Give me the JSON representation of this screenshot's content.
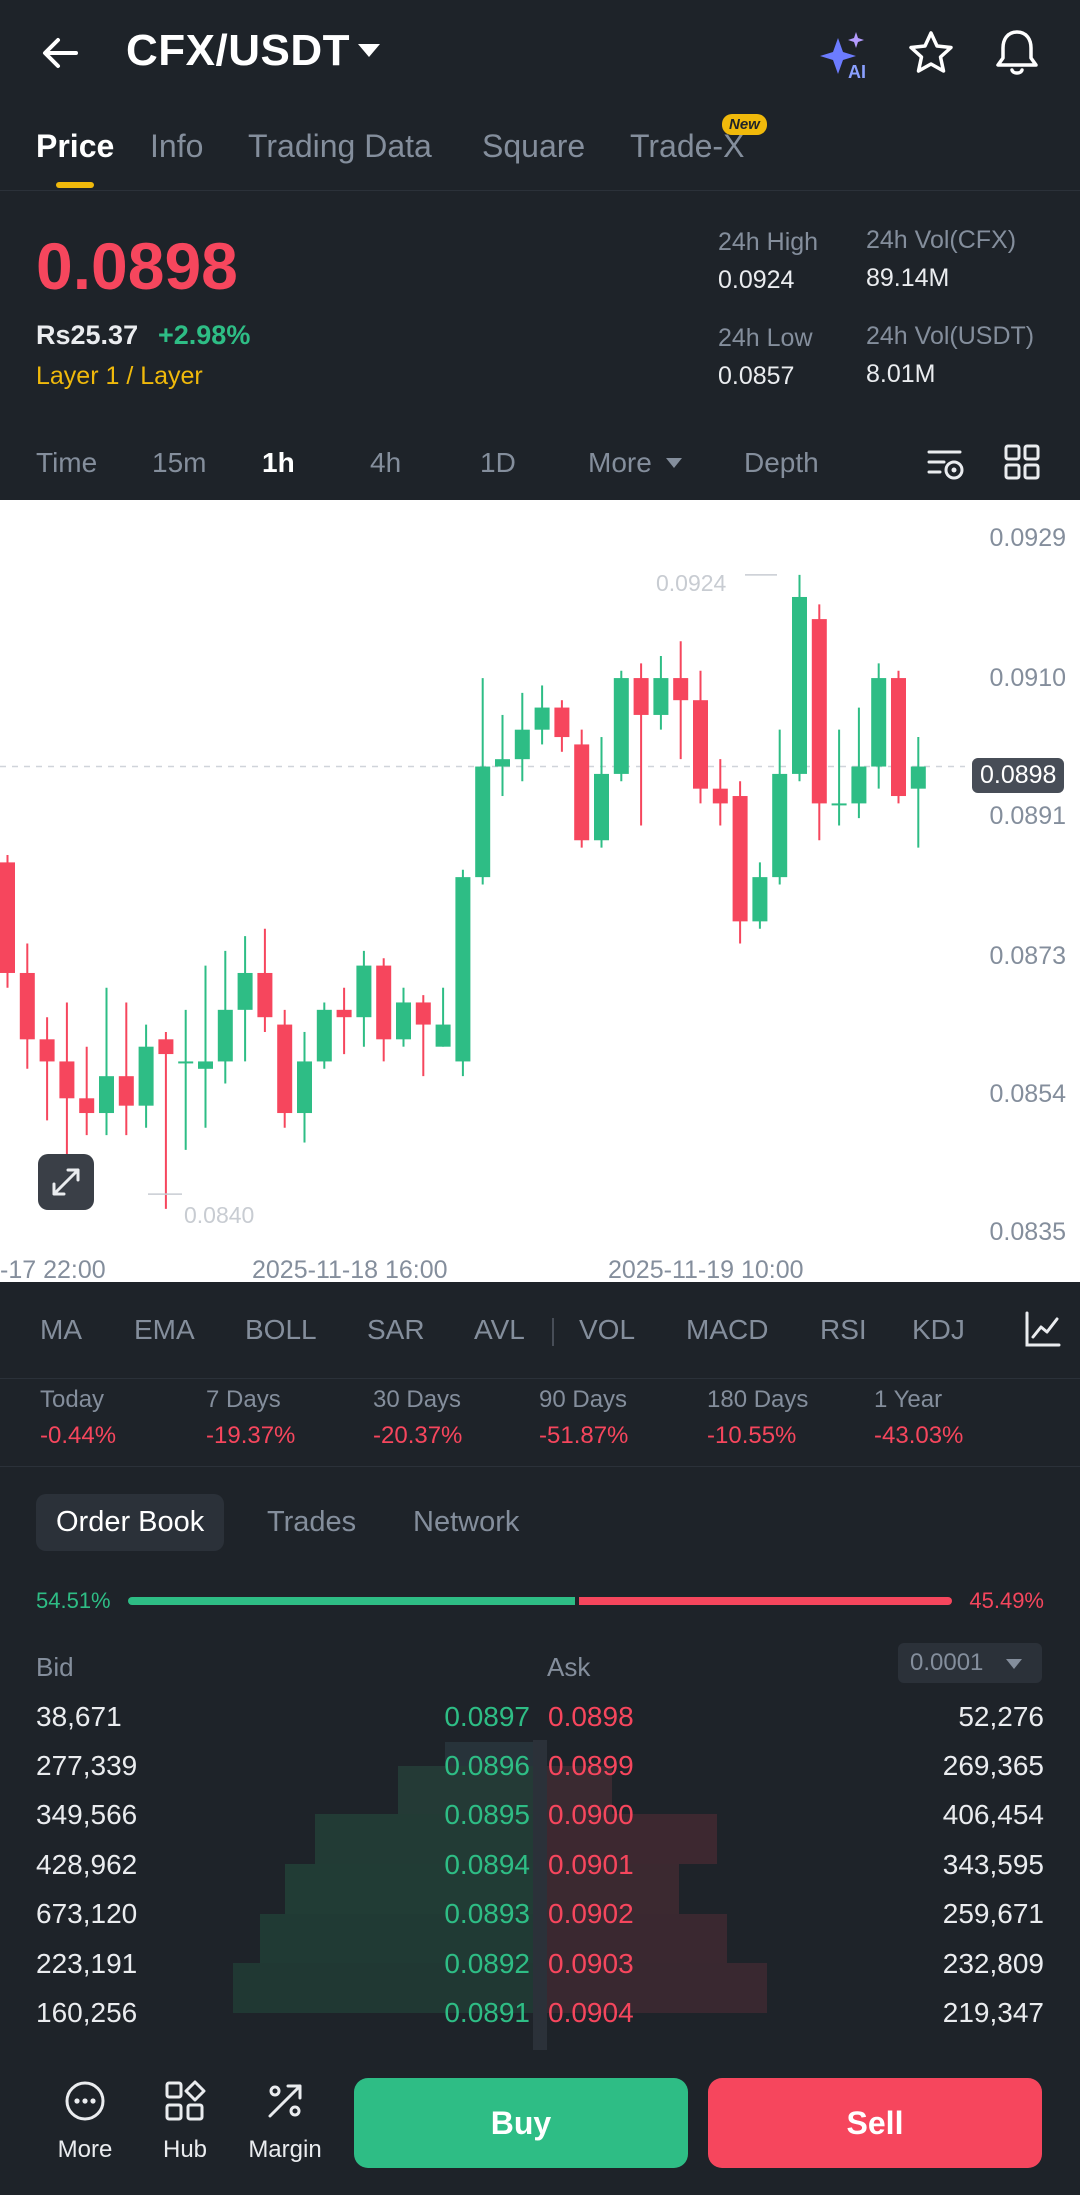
{
  "header": {
    "pair": "CFX/USDT",
    "ai_label": "AI"
  },
  "tabs": [
    {
      "label": "Price",
      "active": true
    },
    {
      "label": "Info"
    },
    {
      "label": "Trading Data"
    },
    {
      "label": "Square"
    },
    {
      "label": "Trade-X",
      "badge": "New"
    }
  ],
  "price": {
    "last": "0.0898",
    "fiat": "Rs25.37",
    "change": "+2.98%",
    "tag": "Layer 1 / Layer"
  },
  "stats": {
    "high_label": "24h High",
    "high": "0.0924",
    "low_label": "24h Low",
    "low": "0.0857",
    "vol_base_label": "24h Vol(CFX)",
    "vol_base": "89.14M",
    "vol_quote_label": "24h Vol(USDT)",
    "vol_quote": "8.01M"
  },
  "intervals": [
    "Time",
    "15m",
    "1h",
    "4h",
    "1D",
    "More",
    "Depth"
  ],
  "active_interval": "1h",
  "chart_data": {
    "type": "candlestick",
    "y_ticks": [
      "0.0929",
      "0.0910",
      "0.0891",
      "0.0873",
      "0.0854",
      "0.0835"
    ],
    "x_ticks": [
      "-17 22:00",
      "2025-11-18 16:00",
      "2025-11-19 10:00"
    ],
    "high_label": "0.0924",
    "low_label": "0.0840",
    "current_price": "0.0898",
    "ylim": [
      0.0835,
      0.0929
    ],
    "candles": [
      {
        "o": 0.0885,
        "c": 0.087,
        "h": 0.0886,
        "l": 0.0868
      },
      {
        "o": 0.087,
        "c": 0.0861,
        "h": 0.0874,
        "l": 0.0857
      },
      {
        "o": 0.0861,
        "c": 0.0858,
        "h": 0.0864,
        "l": 0.085
      },
      {
        "o": 0.0858,
        "c": 0.0853,
        "h": 0.0866,
        "l": 0.0843
      },
      {
        "o": 0.0853,
        "c": 0.0851,
        "h": 0.086,
        "l": 0.0848
      },
      {
        "o": 0.0851,
        "c": 0.0856,
        "h": 0.0868,
        "l": 0.0848
      },
      {
        "o": 0.0856,
        "c": 0.0852,
        "h": 0.0866,
        "l": 0.0848
      },
      {
        "o": 0.0852,
        "c": 0.086,
        "h": 0.0863,
        "l": 0.0849
      },
      {
        "o": 0.0861,
        "c": 0.0859,
        "h": 0.0862,
        "l": 0.0838
      },
      {
        "o": 0.0858,
        "c": 0.0858,
        "h": 0.0865,
        "l": 0.0846
      },
      {
        "o": 0.0857,
        "c": 0.0858,
        "h": 0.0871,
        "l": 0.0849
      },
      {
        "o": 0.0858,
        "c": 0.0865,
        "h": 0.0873,
        "l": 0.0855
      },
      {
        "o": 0.0865,
        "c": 0.087,
        "h": 0.0875,
        "l": 0.0858
      },
      {
        "o": 0.087,
        "c": 0.0864,
        "h": 0.0876,
        "l": 0.0862
      },
      {
        "o": 0.0863,
        "c": 0.0851,
        "h": 0.0865,
        "l": 0.0849
      },
      {
        "o": 0.0851,
        "c": 0.0858,
        "h": 0.0862,
        "l": 0.0847
      },
      {
        "o": 0.0858,
        "c": 0.0865,
        "h": 0.0866,
        "l": 0.0857
      },
      {
        "o": 0.0865,
        "c": 0.0864,
        "h": 0.0868,
        "l": 0.0859
      },
      {
        "o": 0.0864,
        "c": 0.0871,
        "h": 0.0873,
        "l": 0.086
      },
      {
        "o": 0.0871,
        "c": 0.0861,
        "h": 0.0872,
        "l": 0.0858
      },
      {
        "o": 0.0861,
        "c": 0.0866,
        "h": 0.0868,
        "l": 0.086
      },
      {
        "o": 0.0866,
        "c": 0.0863,
        "h": 0.0867,
        "l": 0.0856
      },
      {
        "o": 0.086,
        "c": 0.0863,
        "h": 0.0868,
        "l": 0.086
      },
      {
        "o": 0.0858,
        "c": 0.0883,
        "h": 0.0884,
        "l": 0.0856
      },
      {
        "o": 0.0883,
        "c": 0.0898,
        "h": 0.091,
        "l": 0.0882
      },
      {
        "o": 0.0898,
        "c": 0.0899,
        "h": 0.0905,
        "l": 0.0894
      },
      {
        "o": 0.0899,
        "c": 0.0903,
        "h": 0.0908,
        "l": 0.0896
      },
      {
        "o": 0.0903,
        "c": 0.0906,
        "h": 0.0909,
        "l": 0.0901
      },
      {
        "o": 0.0906,
        "c": 0.0902,
        "h": 0.0907,
        "l": 0.09
      },
      {
        "o": 0.0901,
        "c": 0.0888,
        "h": 0.0903,
        "l": 0.0887
      },
      {
        "o": 0.0888,
        "c": 0.0897,
        "h": 0.0902,
        "l": 0.0887
      },
      {
        "o": 0.0897,
        "c": 0.091,
        "h": 0.0911,
        "l": 0.0896
      },
      {
        "o": 0.091,
        "c": 0.0905,
        "h": 0.0912,
        "l": 0.089
      },
      {
        "o": 0.0905,
        "c": 0.091,
        "h": 0.0913,
        "l": 0.0903
      },
      {
        "o": 0.091,
        "c": 0.0907,
        "h": 0.0915,
        "l": 0.0899
      },
      {
        "o": 0.0907,
        "c": 0.0895,
        "h": 0.0911,
        "l": 0.0893
      },
      {
        "o": 0.0895,
        "c": 0.0893,
        "h": 0.0899,
        "l": 0.089
      },
      {
        "o": 0.0894,
        "c": 0.0877,
        "h": 0.0896,
        "l": 0.0874
      },
      {
        "o": 0.0877,
        "c": 0.0883,
        "h": 0.0885,
        "l": 0.0876
      },
      {
        "o": 0.0883,
        "c": 0.0897,
        "h": 0.0903,
        "l": 0.0882
      },
      {
        "o": 0.0897,
        "c": 0.0921,
        "h": 0.0924,
        "l": 0.0896
      },
      {
        "o": 0.0918,
        "c": 0.0893,
        "h": 0.092,
        "l": 0.0888
      },
      {
        "o": 0.0893,
        "c": 0.0893,
        "h": 0.0903,
        "l": 0.089
      },
      {
        "o": 0.0893,
        "c": 0.0898,
        "h": 0.0906,
        "l": 0.0891
      },
      {
        "o": 0.0898,
        "c": 0.091,
        "h": 0.0912,
        "l": 0.0895
      },
      {
        "o": 0.091,
        "c": 0.0894,
        "h": 0.0911,
        "l": 0.0893
      },
      {
        "o": 0.0895,
        "c": 0.0898,
        "h": 0.0902,
        "l": 0.0887
      }
    ]
  },
  "indicators": [
    "MA",
    "EMA",
    "BOLL",
    "SAR",
    "AVL",
    "VOL",
    "MACD",
    "RSI",
    "KDJ"
  ],
  "performance": [
    {
      "label": "Today",
      "value": "-0.44%"
    },
    {
      "label": "7 Days",
      "value": "-19.37%"
    },
    {
      "label": "30 Days",
      "value": "-20.37%"
    },
    {
      "label": "90 Days",
      "value": "-51.87%"
    },
    {
      "label": "180 Days",
      "value": "-10.55%"
    },
    {
      "label": "1 Year",
      "value": "-43.03%"
    }
  ],
  "orderbook": {
    "tabs": [
      "Order Book",
      "Trades",
      "Network"
    ],
    "bid_pct": "54.51%",
    "ask_pct": "45.49%",
    "bid_ratio": 0.5451,
    "bid_label": "Bid",
    "ask_label": "Ask",
    "precision": "0.0001",
    "rows": [
      {
        "bq": "38,671",
        "bp": "0.0897",
        "ap": "0.0898",
        "aq": "52,276"
      },
      {
        "bq": "277,339",
        "bp": "0.0896",
        "ap": "0.0899",
        "aq": "269,365"
      },
      {
        "bq": "349,566",
        "bp": "0.0895",
        "ap": "0.0900",
        "aq": "406,454"
      },
      {
        "bq": "428,962",
        "bp": "0.0894",
        "ap": "0.0901",
        "aq": "343,595"
      },
      {
        "bq": "673,120",
        "bp": "0.0893",
        "ap": "0.0902",
        "aq": "259,671"
      },
      {
        "bq": "223,191",
        "bp": "0.0892",
        "ap": "0.0903",
        "aq": "232,809"
      },
      {
        "bq": "160,256",
        "bp": "0.0891",
        "ap": "0.0904",
        "aq": "219,347"
      }
    ]
  },
  "bottom": {
    "more": "More",
    "hub": "Hub",
    "margin": "Margin",
    "buy": "Buy",
    "sell": "Sell"
  },
  "colors": {
    "up": "#2ebd85",
    "down": "#f6465d",
    "accent": "#f0b90b",
    "bg": "#1e2329"
  }
}
